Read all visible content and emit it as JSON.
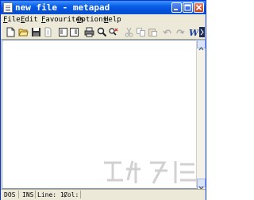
{
  "window": {
    "title": "new file - metapad"
  },
  "menu": [
    {
      "label": "File",
      "accel": "F",
      "rest": "ile"
    },
    {
      "label": "Edit",
      "accel": "E",
      "rest": "dit"
    },
    {
      "label": "Favourites",
      "accel": "F",
      "rest": "avourites"
    },
    {
      "label": "Options",
      "accel": "O",
      "rest": "ptions"
    },
    {
      "label": "Help",
      "accel": "H",
      "rest": "elp"
    }
  ],
  "toolbar": [
    "new-file-icon",
    "open-folder-icon",
    "save-icon",
    "print-preview-icon",
    "align-left-icon",
    "help-box-icon",
    "print-icon",
    "find-icon",
    "replace-icon",
    "cut-icon",
    "copy-icon",
    "paste-icon",
    "undo-icon",
    "redo-icon",
    "word-wrap-icon"
  ],
  "editor": {
    "content": ""
  },
  "status": {
    "format": "DOS",
    "mode": "INS",
    "line": "Line: 1/",
    "col": "Col:"
  },
  "colors": {
    "titlebar": "#0a5ee8",
    "chrome": "#ece9d8"
  }
}
